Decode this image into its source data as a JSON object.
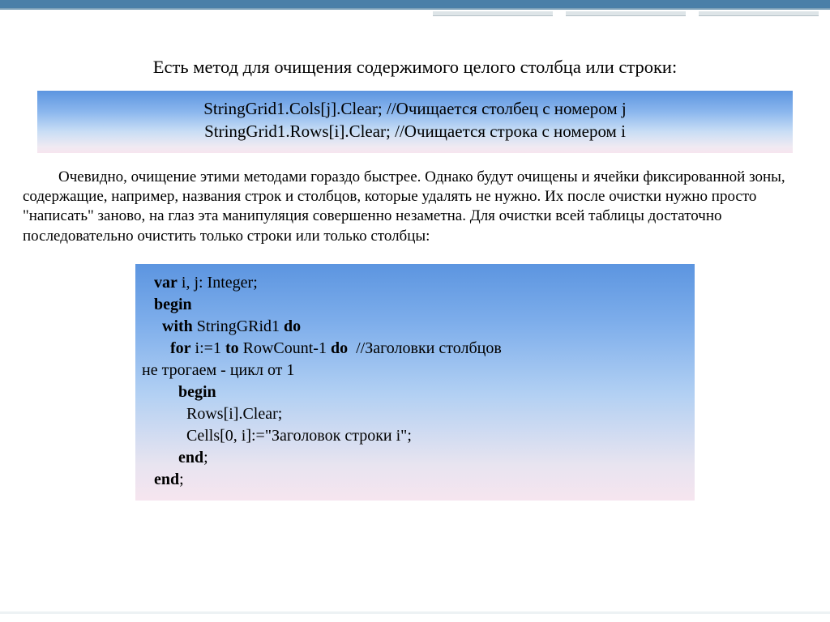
{
  "title": "Есть метод для очищения содержимого целого столбца или строки:",
  "code1": {
    "line1": "StringGrid1.Cols[j].Clear;  //Очищается столбец с номером j",
    "line2": "StringGrid1.Rows[i].Clear;  //Очищается строка с номером i"
  },
  "paragraph": "Очевидно, очищение этими методами гораздо быстрее. Однако будут очищены и ячейки фиксированной зоны, содержащие, например, названия строк и столбцов, которые удалять не нужно. Их после очистки нужно просто \"написать\" заново, на глаз эта манипуляция совершенно незаметна. Для очистки всей таблицы достаточно последовательно очистить только строки или только столбцы:",
  "code2": {
    "l1_kw1": "var",
    "l1_rest": " i, j: Integer;",
    "l2_kw": "begin",
    "l3_kw1": "with",
    "l3_mid": " StringGRid1 ",
    "l3_kw2": "do",
    "l4_kw1": "for",
    "l4_mid1": " i:=1 ",
    "l4_kw2": "to",
    "l4_mid2": " RowCount-1 ",
    "l4_kw3": "do",
    "l4_cmt": "  //Заголовки столбцов",
    "l5": "не трогаем - цикл от 1",
    "l6_kw": "begin",
    "l7": "Rows[i].Clear;",
    "l8": "Cells[0, i]:=\"Заголовок строки i\";",
    "l9_kw": "end",
    "l9_semi": ";",
    "l10_kw": "end",
    "l10_semi": ";"
  }
}
